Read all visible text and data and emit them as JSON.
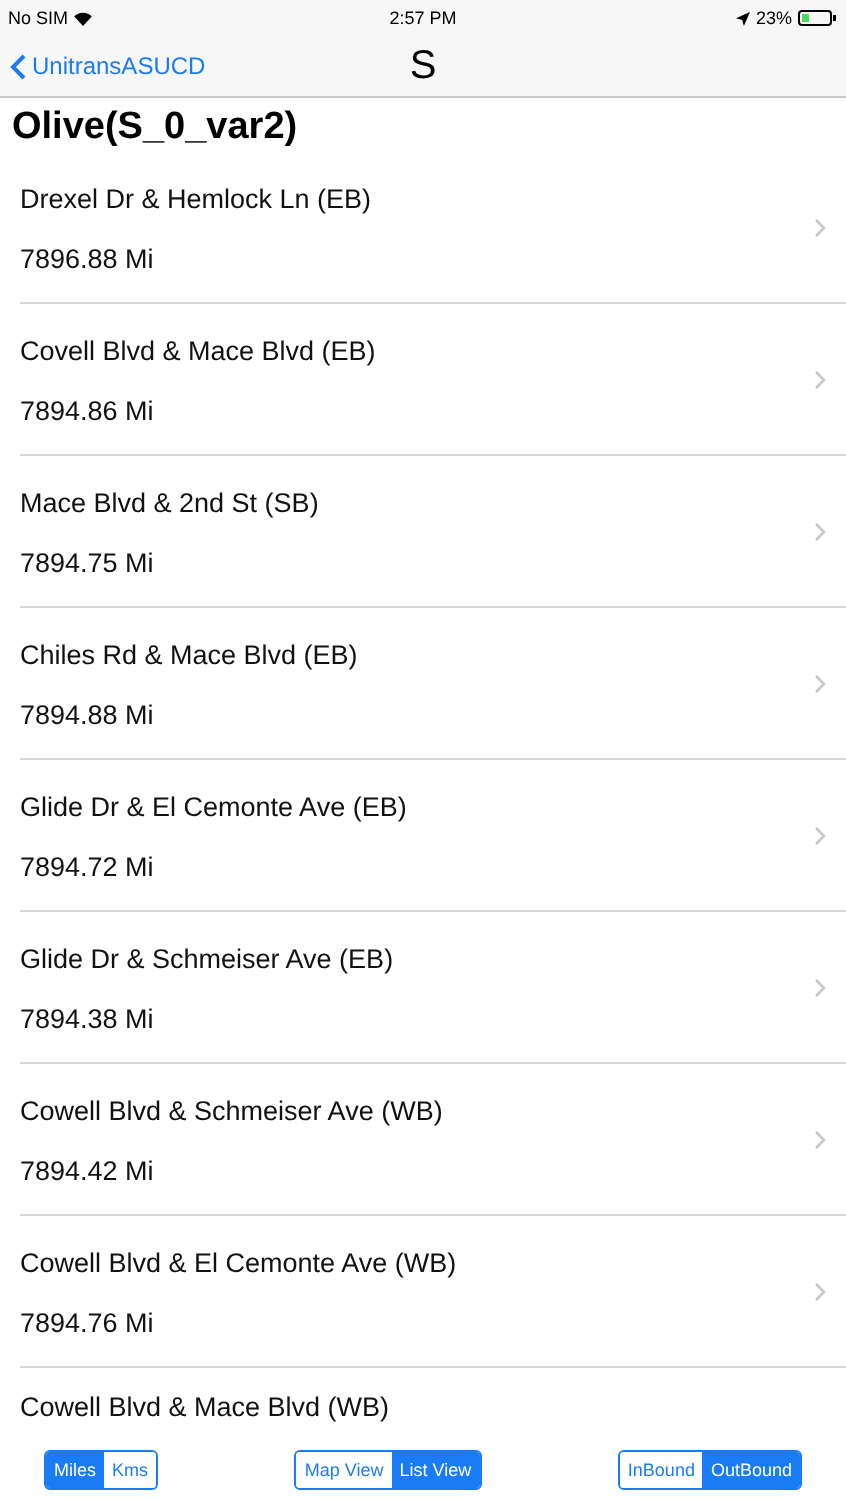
{
  "status_bar": {
    "carrier": "No SIM",
    "time": "2:57 PM",
    "battery": "23%"
  },
  "nav": {
    "back": "UnitransASUCD",
    "title": "S"
  },
  "route_title": "Olive(S_0_var2)",
  "stops": [
    {
      "name": "Drexel Dr & Hemlock Ln (EB)",
      "distance": "7896.88 Mi"
    },
    {
      "name": "Covell Blvd & Mace Blvd (EB)",
      "distance": "7894.86 Mi"
    },
    {
      "name": "Mace Blvd & 2nd St (SB)",
      "distance": "7894.75 Mi"
    },
    {
      "name": "Chiles Rd & Mace Blvd (EB)",
      "distance": "7894.88 Mi"
    },
    {
      "name": "Glide Dr & El Cemonte Ave (EB)",
      "distance": "7894.72 Mi"
    },
    {
      "name": "Glide Dr & Schmeiser Ave (EB)",
      "distance": "7894.38 Mi"
    },
    {
      "name": "Cowell Blvd & Schmeiser Ave (WB)",
      "distance": "7894.42 Mi"
    },
    {
      "name": "Cowell Blvd & El Cemonte Ave (WB)",
      "distance": "7894.76 Mi"
    },
    {
      "name": "Cowell Blvd & Mace Blvd (WB)"
    }
  ],
  "toolbar": [
    [
      {
        "label": "Miles",
        "selected": true
      },
      {
        "label": "Kms",
        "selected": false
      }
    ],
    [
      {
        "label": "Map View",
        "selected": false
      },
      {
        "label": "List View",
        "selected": true
      }
    ],
    [
      {
        "label": "InBound",
        "selected": false
      },
      {
        "label": "OutBound",
        "selected": true
      }
    ]
  ]
}
